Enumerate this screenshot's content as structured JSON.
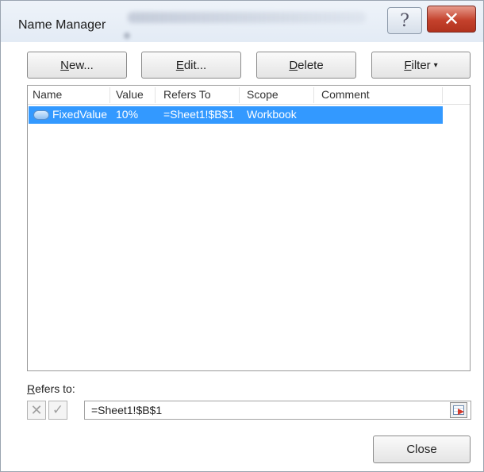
{
  "window": {
    "title": "Name Manager",
    "help_glyph": "?",
    "close_glyph": "✕"
  },
  "toolbar": {
    "new_access_key": "N",
    "new_rest": "ew...",
    "edit_access_key": "E",
    "edit_rest": "dit...",
    "delete_access_key": "D",
    "delete_rest": "elete",
    "filter_access_key": "F",
    "filter_rest": "ilter",
    "filter_caret": "▾"
  },
  "list": {
    "columns": [
      "Name",
      "Value",
      "Refers To",
      "Scope",
      "Comment"
    ],
    "rows": [
      {
        "name": "FixedValue",
        "value": "10%",
        "refers_to": "=Sheet1!$B$1",
        "scope": "Workbook",
        "comment": "",
        "selected": true,
        "icon": "defined-name-icon"
      }
    ]
  },
  "refers": {
    "label_access_key": "R",
    "label_rest": "efers to:",
    "value": "=Sheet1!$B$1",
    "cancel_glyph": "✕",
    "ok_glyph": "✓"
  },
  "footer": {
    "close_label": "Close"
  },
  "colors": {
    "selection": "#3399ff",
    "close_button": "#c4412c"
  }
}
